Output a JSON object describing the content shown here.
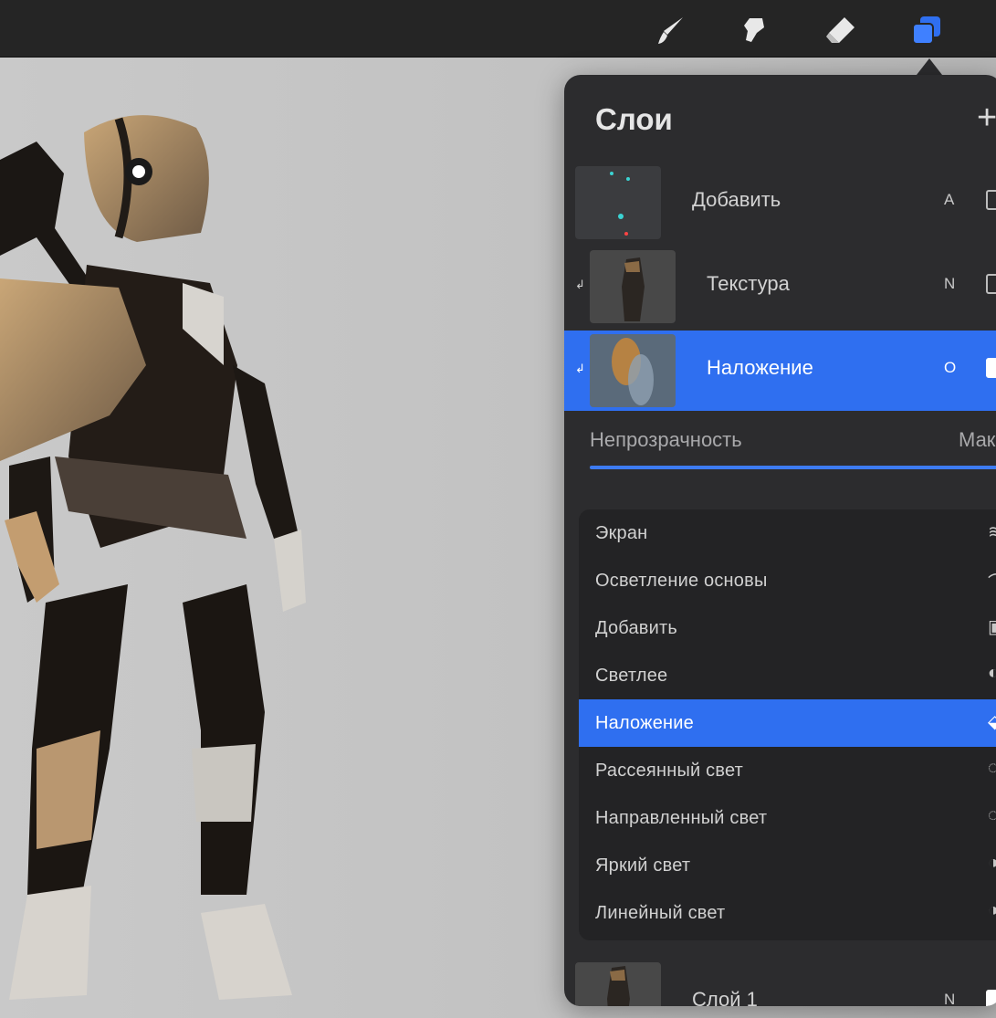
{
  "toolbar": {
    "tools": [
      {
        "name": "brush-icon"
      },
      {
        "name": "smudge-icon"
      },
      {
        "name": "eraser-icon"
      },
      {
        "name": "layers-icon",
        "active": true
      }
    ],
    "accent": "#2f6ff0"
  },
  "layers_panel": {
    "title": "Слои",
    "add_symbol": "+",
    "layers": [
      {
        "name": "Добавить",
        "blend": "A",
        "clipped": false,
        "selected": false
      },
      {
        "name": "Текстура",
        "blend": "N",
        "clipped": true,
        "selected": false
      },
      {
        "name": "Наложение",
        "blend": "O",
        "clipped": true,
        "selected": true
      }
    ],
    "opacity": {
      "label": "Непрозрачность",
      "value": "Мак"
    },
    "blend_modes": [
      {
        "label": "Экран",
        "icon": "screen-icon"
      },
      {
        "label": "Осветление основы",
        "icon": "color-dodge-icon"
      },
      {
        "label": "Добавить",
        "icon": "add-icon"
      },
      {
        "label": "Светлее",
        "icon": "lighter-icon"
      },
      {
        "label": "Наложение",
        "icon": "overlay-icon",
        "active": true
      },
      {
        "label": "Рассеянный свет",
        "icon": "soft-light-icon"
      },
      {
        "label": "Направленный свет",
        "icon": "hard-light-icon"
      },
      {
        "label": "Яркий свет",
        "icon": "vivid-light-icon"
      },
      {
        "label": "Линейный свет",
        "icon": "linear-light-icon"
      }
    ],
    "bottom_layer": {
      "name": "Слой 1",
      "blend": "N"
    }
  }
}
